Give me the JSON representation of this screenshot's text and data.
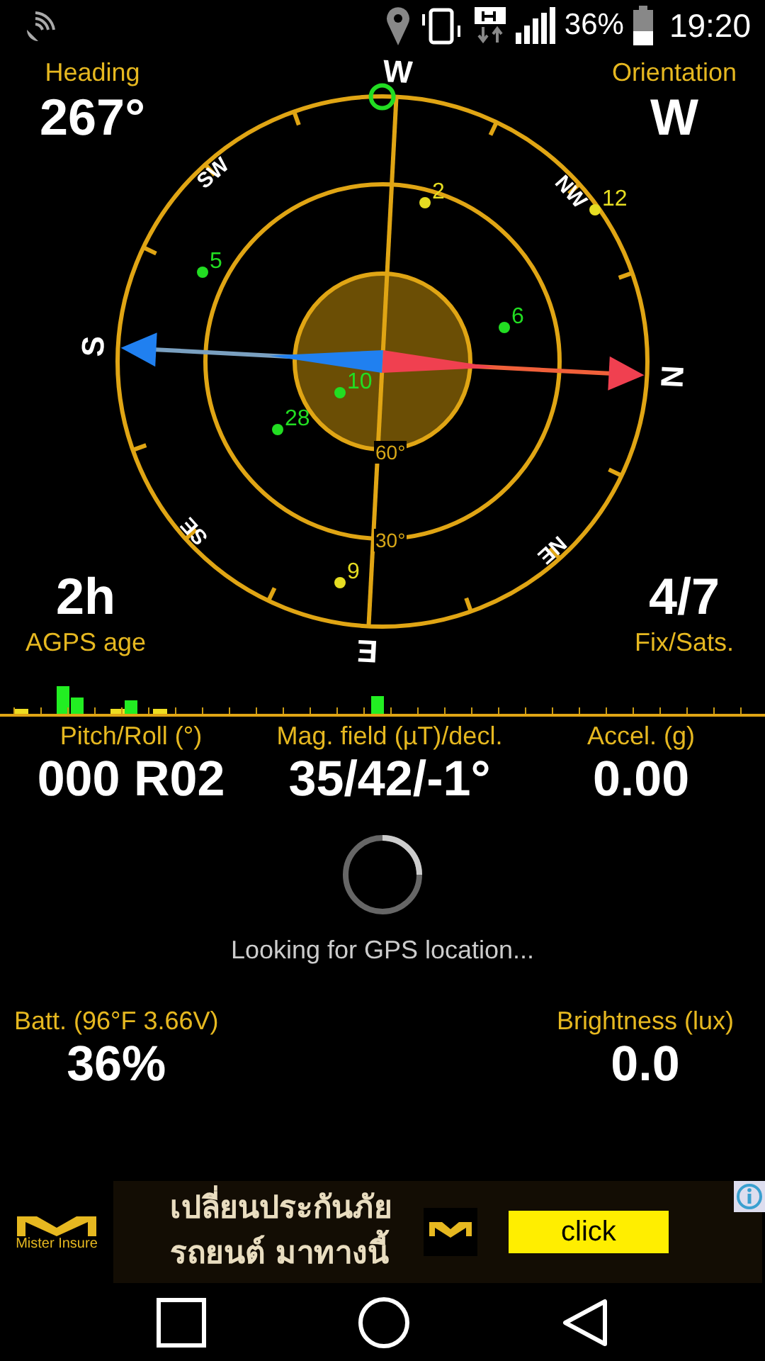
{
  "status_bar": {
    "battery_text": "36%",
    "time": "19:20"
  },
  "compass": {
    "heading": {
      "label": "Heading",
      "value": "267°"
    },
    "orientation": {
      "label": "Orientation",
      "value": "W"
    },
    "agps": {
      "label": "AGPS age",
      "value": "2h"
    },
    "fix": {
      "label": "Fix/Sats.",
      "value": "4/7"
    },
    "directions": [
      "N",
      "NE",
      "E",
      "SE",
      "S",
      "SW",
      "W",
      "NW"
    ],
    "ring_labels": [
      "60°",
      "30°"
    ],
    "satellites": [
      {
        "label": "5",
        "color": "#22dd22"
      },
      {
        "label": "6",
        "color": "#22dd22"
      },
      {
        "label": "10",
        "color": "#22dd22"
      },
      {
        "label": "28",
        "color": "#22dd22"
      },
      {
        "label": "2",
        "color": "#e6dd22"
      },
      {
        "label": "12",
        "color": "#e6dd22"
      },
      {
        "label": "9",
        "color": "#e6dd22"
      }
    ]
  },
  "readings": [
    {
      "label": "Pitch/Roll (°)",
      "value": "000 R02"
    },
    {
      "label": "Mag. field (µT)/decl.",
      "value": "35/42/-1°"
    },
    {
      "label": "Accel. (g)",
      "value": "0.00"
    }
  ],
  "status_message": "Looking for GPS location...",
  "sensors": [
    {
      "label": "Batt. (96°F 3.66V)",
      "value": "36%"
    },
    {
      "label": "Brightness (lux)",
      "value": "0.0"
    }
  ],
  "ad": {
    "brand": "Mister Insure",
    "text_lines": [
      "เปลี่ยนประกันภัย",
      "รถยนต์ มาทางนี้"
    ],
    "button": "click"
  }
}
